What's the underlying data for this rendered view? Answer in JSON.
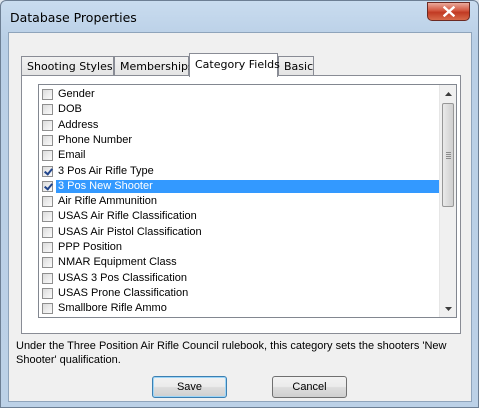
{
  "window": {
    "title": "Database Properties"
  },
  "tabs": [
    {
      "label": "Shooting Styles"
    },
    {
      "label": "Memberships"
    },
    {
      "label": "Category Fields"
    },
    {
      "label": "Basic"
    }
  ],
  "active_tab": "Category Fields",
  "fields": [
    {
      "label": "Gender",
      "checked": false
    },
    {
      "label": "DOB",
      "checked": false
    },
    {
      "label": "Address",
      "checked": false
    },
    {
      "label": "Phone Number",
      "checked": false
    },
    {
      "label": "Email",
      "checked": false
    },
    {
      "label": "3 Pos Air Rifle Type",
      "checked": true
    },
    {
      "label": "3 Pos New Shooter",
      "checked": true,
      "selected": true
    },
    {
      "label": "Air Rifle Ammunition",
      "checked": false
    },
    {
      "label": "USAS Air Rifle Classification",
      "checked": false
    },
    {
      "label": "USAS Air Pistol Classification",
      "checked": false
    },
    {
      "label": "PPP Position",
      "checked": false
    },
    {
      "label": "NMAR Equipment Class",
      "checked": false
    },
    {
      "label": "USAS 3 Pos Classification",
      "checked": false
    },
    {
      "label": "USAS Prone Classification",
      "checked": false
    },
    {
      "label": "Smallbore Rifle Ammo",
      "checked": false
    }
  ],
  "description": "Under the Three Position Air Rifle Council rulebook, this category sets the shooters 'New Shooter' qualification.",
  "buttons": {
    "save_label": "Save",
    "cancel_label": "Cancel"
  }
}
